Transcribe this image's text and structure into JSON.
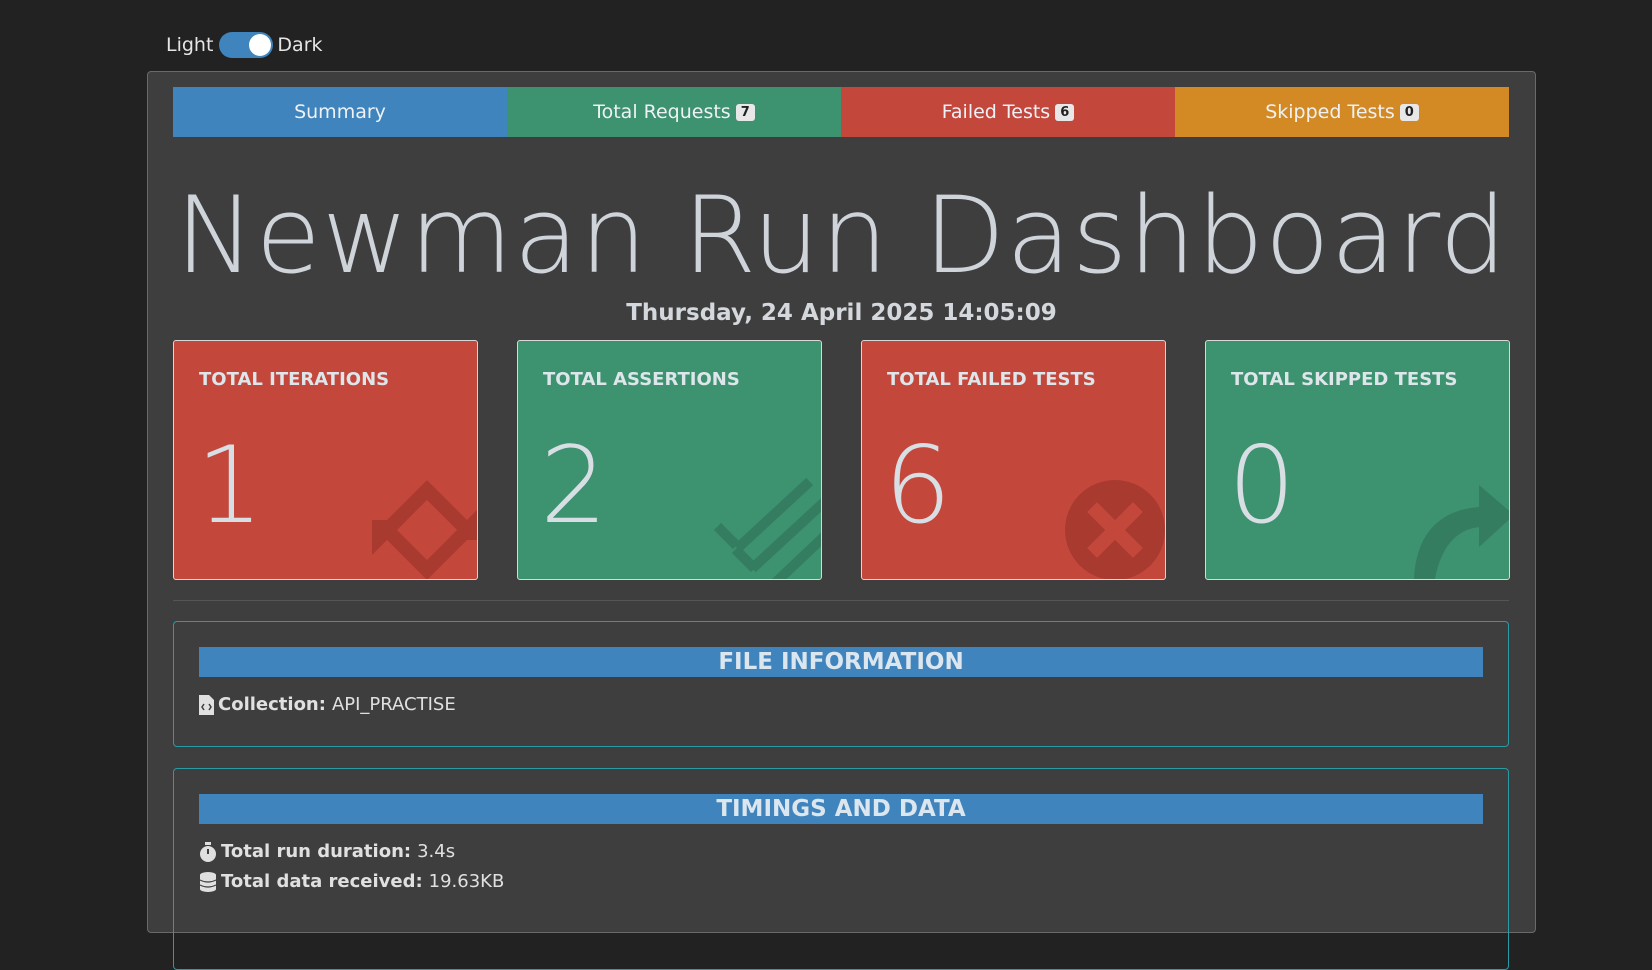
{
  "theme_toggle": {
    "light_label": "Light",
    "dark_label": "Dark"
  },
  "tabs": [
    {
      "label": "Summary"
    },
    {
      "label": "Total Requests",
      "badge": "7"
    },
    {
      "label": "Failed Tests",
      "badge": "6"
    },
    {
      "label": "Skipped Tests",
      "badge": "0"
    }
  ],
  "title": "Newman Run Dashboard",
  "run_date": "Thursday, 24 April 2025 14:05:09",
  "cards": [
    {
      "label": "TOTAL ITERATIONS",
      "value": "1",
      "icon": "sync-icon",
      "color": "#c4473c"
    },
    {
      "label": "TOTAL ASSERTIONS",
      "value": "2",
      "icon": "list-check-icon",
      "color": "#3d9270"
    },
    {
      "label": "TOTAL FAILED TESTS",
      "value": "6",
      "icon": "times-circle-icon",
      "color": "#c4473c"
    },
    {
      "label": "TOTAL SKIPPED TESTS",
      "value": "0",
      "icon": "share-arrow-icon",
      "color": "#3d9270"
    }
  ],
  "file_info": {
    "header": "FILE INFORMATION",
    "collection_label": "Collection:",
    "collection_value": "API_PRACTISE"
  },
  "timings": {
    "header": "TIMINGS AND DATA",
    "duration_label": "Total run duration:",
    "duration_value": "3.4s",
    "data_label": "Total data received:",
    "data_value": "19.63KB"
  },
  "colors": {
    "primary": "#3f84bd",
    "success": "#3d9270",
    "danger": "#c4473c",
    "warning": "#d38a24",
    "info_border": "#2a9aa5"
  }
}
